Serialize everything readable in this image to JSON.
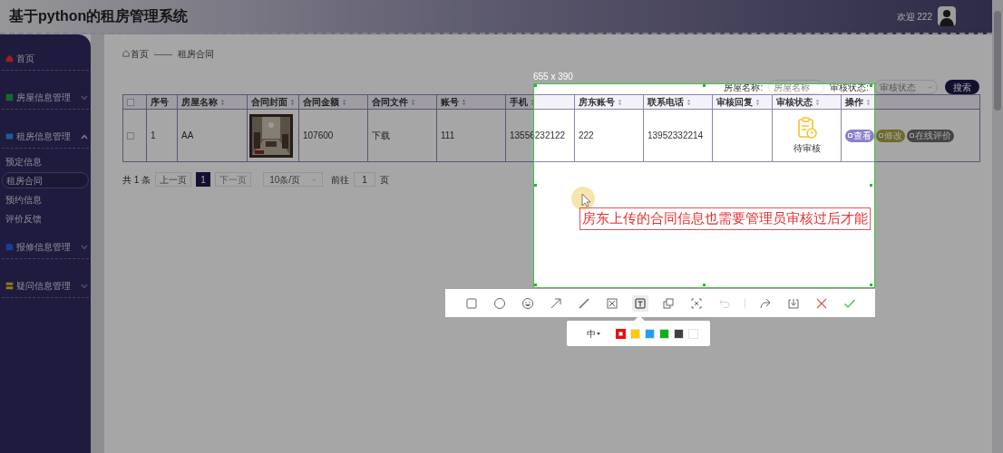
{
  "header": {
    "title": "基于python的租房管理系统",
    "greeting": "欢迎 222"
  },
  "sidebar": {
    "items": [
      {
        "label": "首页",
        "kind": "link"
      },
      {
        "label": "房屋信息管理",
        "kind": "group",
        "expanded": false
      },
      {
        "label": "租房信息管理",
        "kind": "group",
        "expanded": true,
        "children": [
          {
            "label": "预定信息",
            "selected": false
          },
          {
            "label": "租房合同",
            "selected": true
          },
          {
            "label": "预约信息",
            "selected": false
          },
          {
            "label": "评价反馈",
            "selected": false
          }
        ]
      },
      {
        "label": "报修信息管理",
        "kind": "group",
        "expanded": false
      },
      {
        "label": "疑问信息管理",
        "kind": "group",
        "expanded": false
      }
    ]
  },
  "breadcrumb": {
    "home": "首页",
    "separator": "——",
    "current": "租房合同"
  },
  "search": {
    "fields": [
      {
        "kind": "input",
        "label": "房屋名称:",
        "placeholder": "房屋名称"
      },
      {
        "kind": "select",
        "label": "审核状态:",
        "placeholder": "审核状态"
      }
    ],
    "button": "搜索"
  },
  "table": {
    "columns": [
      {
        "kind": "checkbox",
        "checked": false
      },
      {
        "kind": "text",
        "label": "序号",
        "sortable": false
      },
      {
        "kind": "text",
        "label": "房屋名称",
        "sortable": true
      },
      {
        "kind": "text",
        "label": "合同封面",
        "sortable": true
      },
      {
        "kind": "text",
        "label": "合同金额",
        "sortable": true
      },
      {
        "kind": "text",
        "label": "合同文件",
        "sortable": true
      },
      {
        "kind": "text",
        "label": "账号",
        "sortable": true
      },
      {
        "kind": "text",
        "label": "手机",
        "sortable": true
      },
      {
        "kind": "text",
        "label": "房东账号",
        "sortable": true
      },
      {
        "kind": "text",
        "label": "联系电话",
        "sortable": true
      },
      {
        "kind": "text",
        "label": "审核回复",
        "sortable": true
      },
      {
        "kind": "text",
        "label": "审核状态",
        "sortable": true
      },
      {
        "kind": "text",
        "label": "操作",
        "sortable": true
      }
    ],
    "rows": [
      {
        "cells": [
          {
            "kind": "checkbox",
            "checked": false
          },
          {
            "kind": "text",
            "text": "1"
          },
          {
            "kind": "text",
            "text": "AA"
          },
          {
            "kind": "picture"
          },
          {
            "kind": "text",
            "text": "107600"
          },
          {
            "kind": "link",
            "text": "下载"
          },
          {
            "kind": "text",
            "text": "111"
          },
          {
            "kind": "text",
            "text": "13556232122"
          },
          {
            "kind": "text",
            "text": "222"
          },
          {
            "kind": "text",
            "text": "13952332214"
          },
          {
            "kind": "blank"
          },
          {
            "kind": "status",
            "text": "待审核"
          },
          {
            "kind": "actions",
            "actions": [
              {
                "kind": "view",
                "label": "查看"
              },
              {
                "kind": "edit",
                "label": "修改"
              },
              {
                "kind": "review",
                "label": "在线评价"
              }
            ]
          }
        ]
      }
    ]
  },
  "pagination": {
    "total": "共 1 条",
    "prev": "上一页",
    "pages": [
      {
        "label": "1",
        "selected": true
      }
    ],
    "next": "下一页",
    "page_size": "10条/页",
    "goto_label": "前往",
    "goto_value": "1",
    "goto_suffix": "页"
  },
  "screenshot_tool": {
    "size_label": "655 x 390",
    "annotation": "房东上传的合同信息也需要管理员审核过后才能",
    "tools": [
      {
        "kind": "rectangle",
        "selected": false,
        "disabled": false
      },
      {
        "kind": "ellipse",
        "selected": false,
        "disabled": false
      },
      {
        "kind": "emoji",
        "selected": false,
        "disabled": false
      },
      {
        "kind": "arrow",
        "selected": false,
        "disabled": false
      },
      {
        "kind": "line",
        "selected": false,
        "disabled": false
      },
      {
        "kind": "mosaic",
        "selected": false,
        "disabled": false
      },
      {
        "kind": "text",
        "selected": true,
        "disabled": false
      },
      {
        "kind": "pin",
        "selected": false,
        "disabled": false
      },
      {
        "kind": "ocr",
        "selected": false,
        "disabled": false
      },
      {
        "kind": "undo",
        "selected": false,
        "disabled": true
      },
      {
        "kind": "share",
        "selected": false,
        "disabled": false
      },
      {
        "kind": "save",
        "selected": false,
        "disabled": false
      },
      {
        "kind": "cancel",
        "selected": false,
        "disabled": false
      },
      {
        "kind": "confirm",
        "selected": false,
        "disabled": false
      }
    ],
    "font_size": "中",
    "colors": [
      {
        "color": "#ff0000",
        "selected": true
      },
      {
        "color": "#ffc800",
        "selected": false
      },
      {
        "color": "#1ea0f0",
        "selected": false
      },
      {
        "color": "#10b010",
        "selected": false
      },
      {
        "color": "#404040",
        "selected": false
      },
      {
        "color": "#ffffff",
        "selected": false
      }
    ]
  }
}
